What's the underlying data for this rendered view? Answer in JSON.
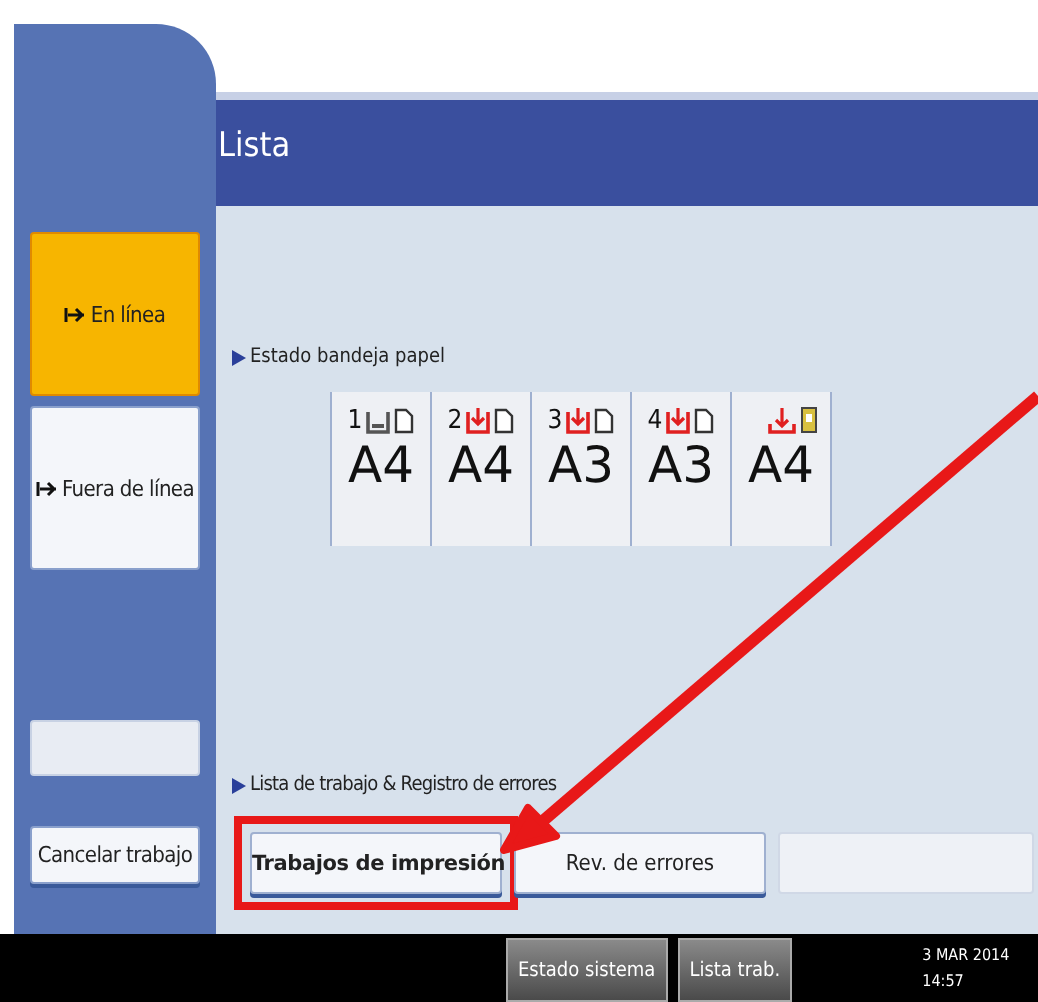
{
  "header": {
    "title": "Lista"
  },
  "side_buttons": [
    {
      "kind": "mode",
      "label": "En línea",
      "selected": true
    },
    {
      "kind": "mode",
      "label": "Fuera de línea",
      "selected": false
    },
    {
      "kind": "disabled"
    },
    {
      "kind": "action",
      "label": "Cancelar trabajo"
    }
  ],
  "paper_trays": {
    "label": "Estado bandeja papel",
    "trays": [
      {
        "kind": "tray",
        "number": "1",
        "alert": false,
        "size": "A4"
      },
      {
        "kind": "tray",
        "number": "2",
        "alert": true,
        "size": "A4"
      },
      {
        "kind": "tray",
        "number": "3",
        "alert": true,
        "size": "A3"
      },
      {
        "kind": "tray",
        "number": "4",
        "alert": true,
        "size": "A3"
      },
      {
        "kind": "bypass",
        "alert": true,
        "size": "A4"
      }
    ]
  },
  "job_section": {
    "label": "Lista de trabajo & Registro de errores",
    "buttons": [
      {
        "label": "Trabajos de impresión",
        "selected": true,
        "disabled": false
      },
      {
        "label": "Rev. de errores",
        "selected": false,
        "disabled": false
      },
      {
        "selected": false,
        "disabled": true
      }
    ]
  },
  "status_bar": {
    "buttons": [
      "Estado sistema",
      "Lista trab."
    ],
    "date": "3 MAR 2014",
    "time": "14:57"
  }
}
